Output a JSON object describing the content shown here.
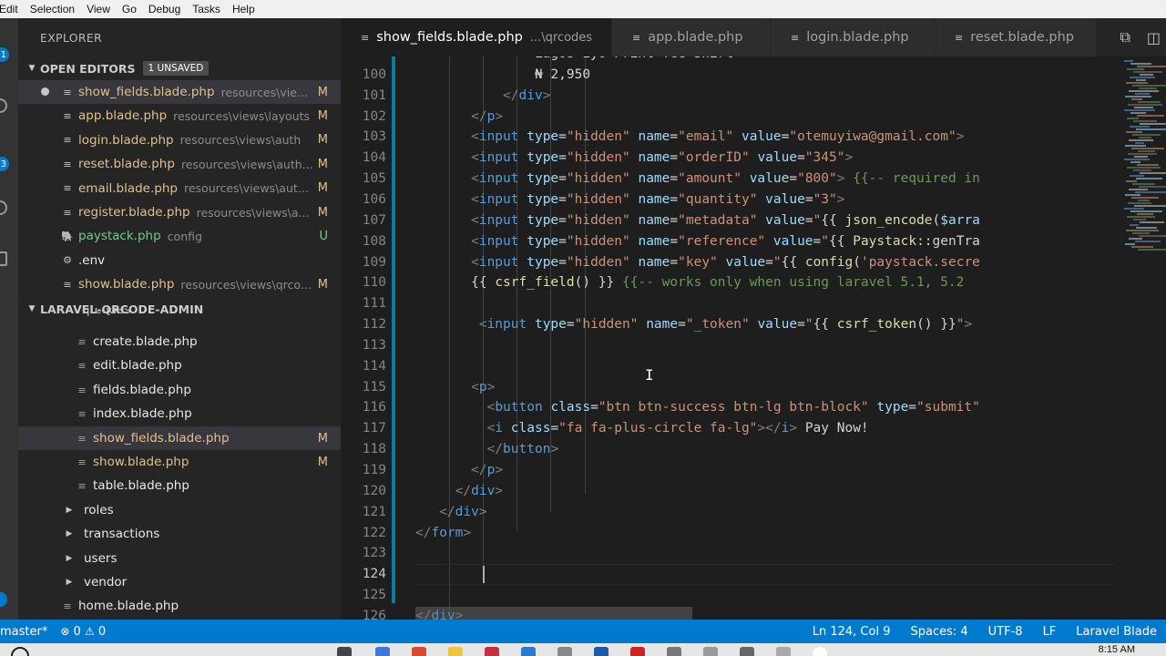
{
  "menu": [
    "Edit",
    "Selection",
    "View",
    "Go",
    "Debug",
    "Tasks",
    "Help"
  ],
  "activity_badges": [
    "1",
    "3"
  ],
  "explorer": {
    "title": "EXPLORER",
    "open_editors": {
      "label": "OPEN EDITORS",
      "badge": "1 UNSAVED",
      "items": [
        {
          "name": "show_fields.blade.php",
          "path": "resources\\vie...",
          "status": "M"
        },
        {
          "name": "app.blade.php",
          "path": "resources\\views\\layouts",
          "status": "M"
        },
        {
          "name": "login.blade.php",
          "path": "resources\\views\\auth",
          "status": "M"
        },
        {
          "name": "reset.blade.php",
          "path": "resources\\views\\auth...",
          "status": "M"
        },
        {
          "name": "email.blade.php",
          "path": "resources\\views\\aut...",
          "status": "M"
        },
        {
          "name": "register.blade.php",
          "path": "resources\\views\\a...",
          "status": "M"
        },
        {
          "name": "paystack.php",
          "path": "config",
          "status": "U"
        },
        {
          "name": ".env",
          "path": "",
          "status": ""
        },
        {
          "name": "show.blade.php",
          "path": "resources\\views\\qrco...",
          "status": "M"
        }
      ]
    },
    "project": {
      "label": "LARAVEL-QRCODE-ADMIN",
      "partial_folder": "qrcodes",
      "files": [
        {
          "name": "create.blade.php",
          "status": ""
        },
        {
          "name": "edit.blade.php",
          "status": ""
        },
        {
          "name": "fields.blade.php",
          "status": ""
        },
        {
          "name": "index.blade.php",
          "status": ""
        },
        {
          "name": "show_fields.blade.php",
          "status": "M"
        },
        {
          "name": "show.blade.php",
          "status": "M"
        },
        {
          "name": "table.blade.php",
          "status": ""
        }
      ],
      "folders": [
        "roles",
        "transactions",
        "users",
        "vendor"
      ],
      "bottom_file": "home.blade.php"
    }
  },
  "tabs": [
    {
      "name": "show_fields.blade.php",
      "desc": "...\\qrcodes"
    },
    {
      "name": "app.blade.php",
      "desc": ""
    },
    {
      "name": "login.blade.php",
      "desc": ""
    },
    {
      "name": "reset.blade.php",
      "desc": ""
    }
  ],
  "code_lines": [
    {
      "n": "",
      "text": "               Lagos Eyo Print Tee Shirt"
    },
    {
      "n": "100",
      "text": "               ₦ 2,950"
    },
    {
      "n": "101",
      "text": "           </div>"
    },
    {
      "n": "102",
      "text": "       </p>"
    },
    {
      "n": "103",
      "text": "       <input type=\"hidden\" name=\"email\" value=\"otemuyiwa@gmail.com\"> "
    },
    {
      "n": "104",
      "text": "       <input type=\"hidden\" name=\"orderID\" value=\"345\">"
    },
    {
      "n": "105",
      "text": "       <input type=\"hidden\" name=\"amount\" value=\"800\"> {{-- required in"
    },
    {
      "n": "106",
      "text": "       <input type=\"hidden\" name=\"quantity\" value=\"3\">"
    },
    {
      "n": "107",
      "text": "       <input type=\"hidden\" name=\"metadata\" value=\"{{ json_encode($arra"
    },
    {
      "n": "108",
      "text": "       <input type=\"hidden\" name=\"reference\" value=\"{{ Paystack::genTra"
    },
    {
      "n": "109",
      "text": "       <input type=\"hidden\" name=\"key\" value=\"{{ config('paystack.secre"
    },
    {
      "n": "110",
      "text": "       {{ csrf_field() }} {{-- works only when using laravel 5.1, 5.2"
    },
    {
      "n": "111",
      "text": ""
    },
    {
      "n": "112",
      "text": "        <input type=\"hidden\" name=\"_token\" value=\"{{ csrf_token() }}\">"
    },
    {
      "n": "113",
      "text": ""
    },
    {
      "n": "114",
      "text": ""
    },
    {
      "n": "115",
      "text": "       <p>"
    },
    {
      "n": "116",
      "text": "         <button class=\"btn btn-success btn-lg btn-block\" type=\"submit\""
    },
    {
      "n": "117",
      "text": "         <i class=\"fa fa-plus-circle fa-lg\"></i> Pay Now!"
    },
    {
      "n": "118",
      "text": "         </button>"
    },
    {
      "n": "119",
      "text": "       </p>"
    },
    {
      "n": "120",
      "text": "     </div>"
    },
    {
      "n": "121",
      "text": "   </div>"
    },
    {
      "n": "122",
      "text": "</form>"
    },
    {
      "n": "123",
      "text": ""
    },
    {
      "n": "124",
      "text": ""
    },
    {
      "n": "125",
      "text": ""
    },
    {
      "n": "126",
      "text": "</div>"
    }
  ],
  "cursor_line": "124",
  "status": {
    "branch": "master*",
    "errors": "0",
    "warnings": "0",
    "position": "Ln 124, Col 9",
    "spaces": "Spaces: 4",
    "encoding": "UTF-8",
    "eol": "LF",
    "language": "Laravel Blade"
  },
  "clock": "8:15 AM",
  "colors": {
    "accent": "#007acc",
    "modified": "#e2c08d",
    "untracked": "#73c991",
    "tag": "#569cd6",
    "attr": "#9cdcfe",
    "string": "#ce9178",
    "comment": "#6a9955"
  }
}
